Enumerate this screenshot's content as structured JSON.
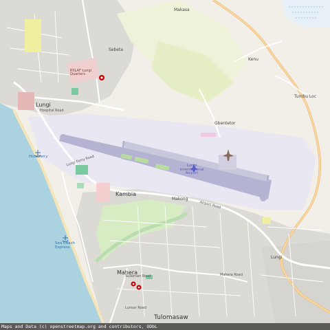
{
  "map": {
    "labels": {
      "makasa": "Makasa",
      "gbendembu_top": "Sebeta",
      "kenu": "Kenu",
      "tombu_loc": "Tumbu Loc",
      "gbendetor": "Gbentetor",
      "rsmlungi": "RSLAF Lungi\nQuarters",
      "lungi_main": "Lungi",
      "hospital_road": "Hospital Road",
      "hotelferry": "Hotelferry",
      "lungi_airport": "Lungi International Airport",
      "kambia": "Kambia",
      "maforki": "Makong",
      "sea_coach": "Sea Coach Express",
      "mahera": "Mahera",
      "tulomasaw": "Tulomasaw",
      "lungi_ferry_road": "Lungi Ferry Road",
      "airport_road": "Airport Road",
      "mahera_road": "Mahera Road",
      "sulaiman_road": "Sulaiman Road",
      "lunsar_road": "Lunsar Road",
      "lungi_loop": "Lungi"
    },
    "attribution": "Maps and Data (c) openstreetmap.org and contributors, ODbL"
  }
}
